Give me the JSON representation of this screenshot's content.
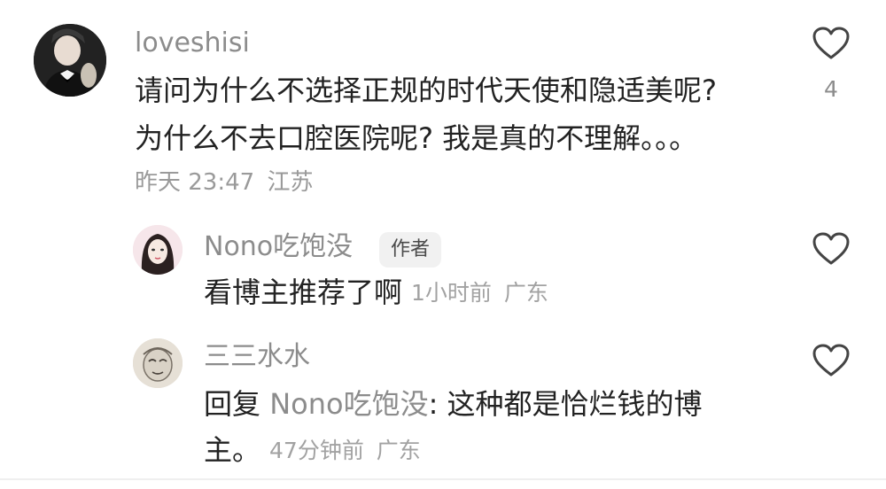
{
  "comments": [
    {
      "username": "loveshisi",
      "text_lines": [
        "请问为什么不选择正规的时代天使和隐适美呢?",
        "为什么不去口腔医院呢? 我是真的不理解。。。"
      ],
      "time": "昨天 23:47",
      "location": "江苏",
      "likes": "4",
      "avatar_icon": "avatar-man-tuxedo"
    }
  ],
  "replies": [
    {
      "username": "Nono吃饱没",
      "badge": "作者",
      "text": "看博主推荐了啊",
      "time": "1小时前",
      "location": "广东",
      "avatar_icon": "avatar-woman-illustration"
    },
    {
      "username": "三三水水",
      "reply_prefix": "回复",
      "reply_to": "Nono吃饱没",
      "reply_colon": ":",
      "text_line1": "这种都是恰烂钱的博",
      "text_line2": "主。",
      "time": "47分钟前",
      "location": "广东",
      "avatar_icon": "avatar-sketch"
    }
  ],
  "icons": {
    "like": "heart-outline-icon"
  },
  "colors": {
    "text": "#222222",
    "secondary": "#8c8c8c",
    "meta": "#9a9a9a",
    "badge_bg": "#f1f1f1"
  }
}
